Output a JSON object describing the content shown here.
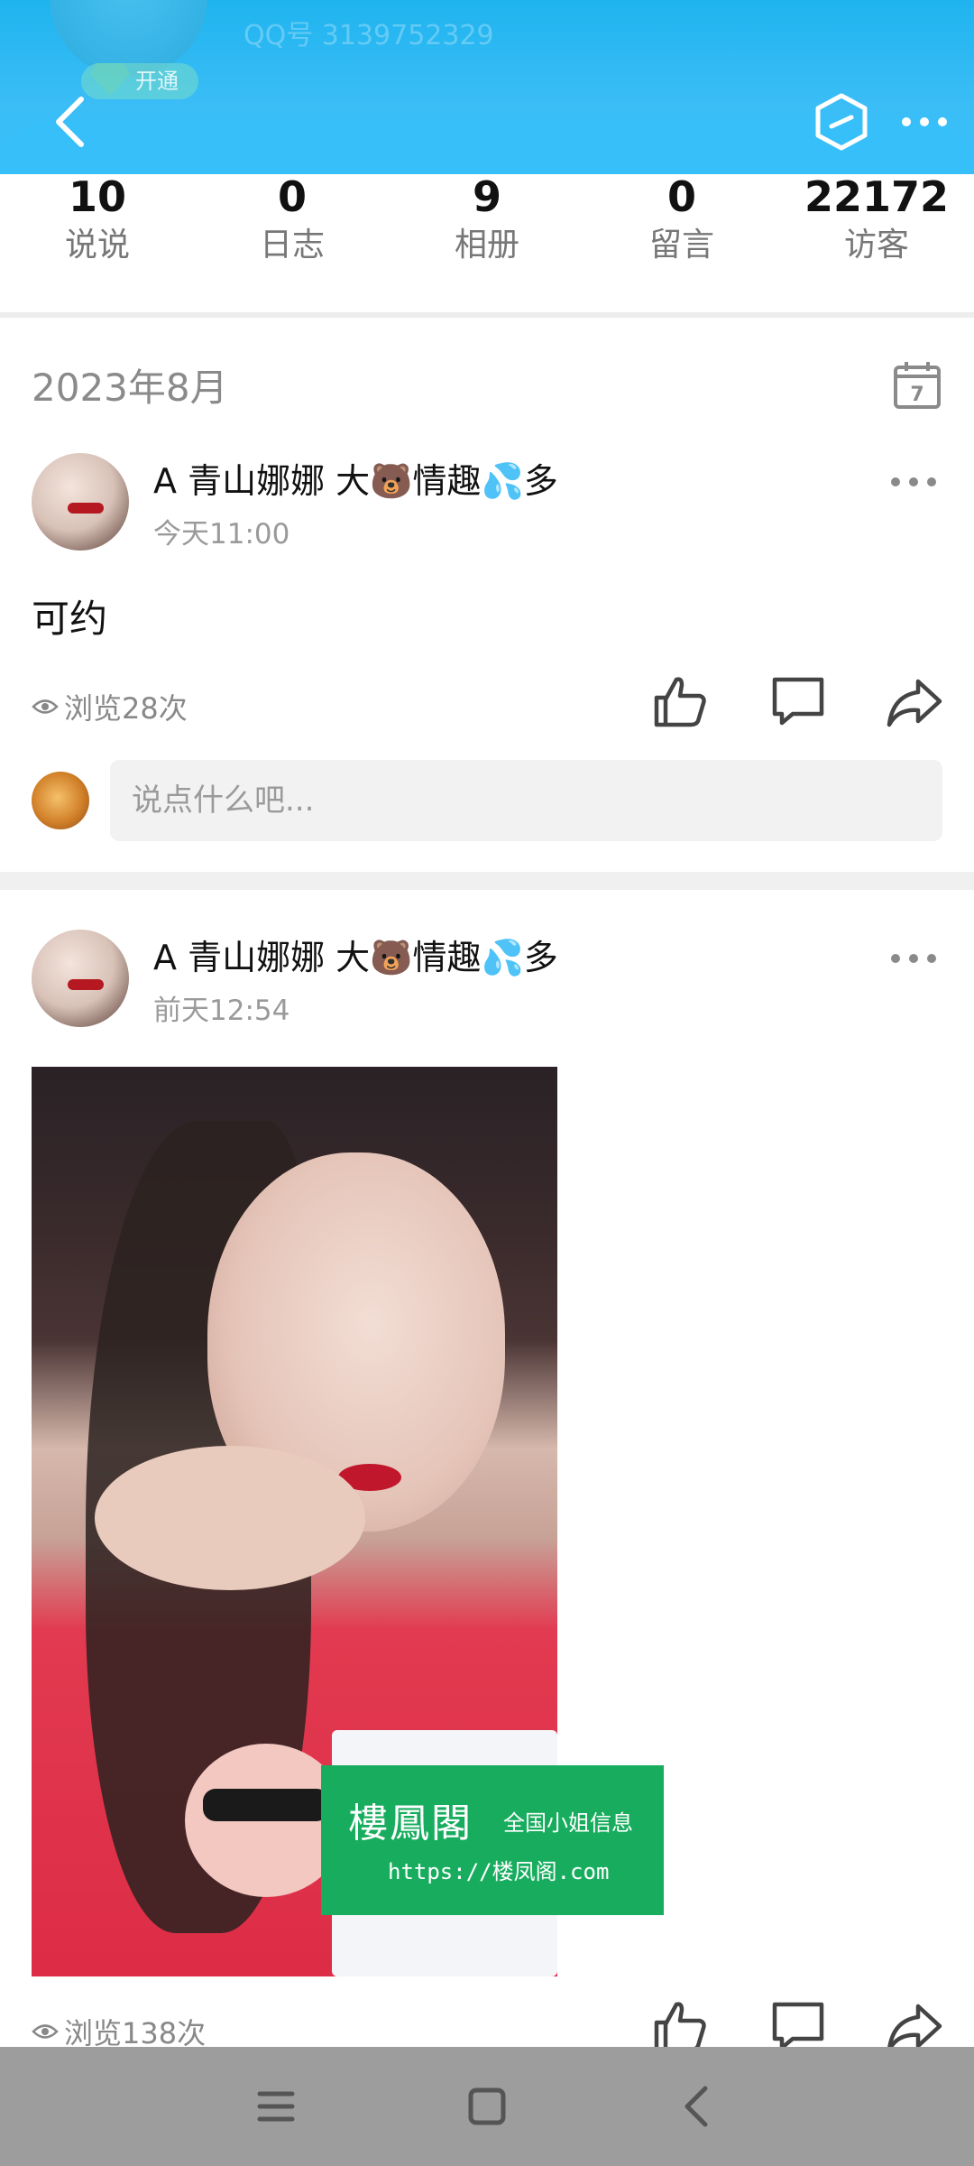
{
  "header": {
    "qq_number": "QQ号 3139752329",
    "vip_label": "开通"
  },
  "stats": [
    {
      "value": "10",
      "label": "说说"
    },
    {
      "value": "0",
      "label": "日志"
    },
    {
      "value": "9",
      "label": "相册"
    },
    {
      "value": "0",
      "label": "留言"
    },
    {
      "value": "22172",
      "label": "访客"
    }
  ],
  "timeline": {
    "month": "2023年8月",
    "calendar_day": "7"
  },
  "posts": [
    {
      "author": "A  青山娜娜 大🐻情趣💦多",
      "time": "今天11:00",
      "content": "可约",
      "views": "浏览28次",
      "comment_placeholder": "说点什么吧..."
    },
    {
      "author": "A  青山娜娜 大🐻情趣💦多",
      "time": "前天12:54",
      "views": "浏览138次"
    }
  ],
  "watermark": {
    "title": "樓鳳閣",
    "subtitle": "全国小姐信息",
    "url": "https://楼凤阁.com"
  },
  "colors": {
    "header_blue": "#1fb4ef",
    "watermark_green": "#18ad5e",
    "navbar_gray": "#9d9d9d"
  },
  "icons": [
    "back-icon",
    "hexagon-icon",
    "more-icon",
    "calendar-icon",
    "eye-icon",
    "like-icon",
    "comment-icon",
    "share-icon",
    "menu-icon",
    "home-icon",
    "nav-back-icon"
  ]
}
